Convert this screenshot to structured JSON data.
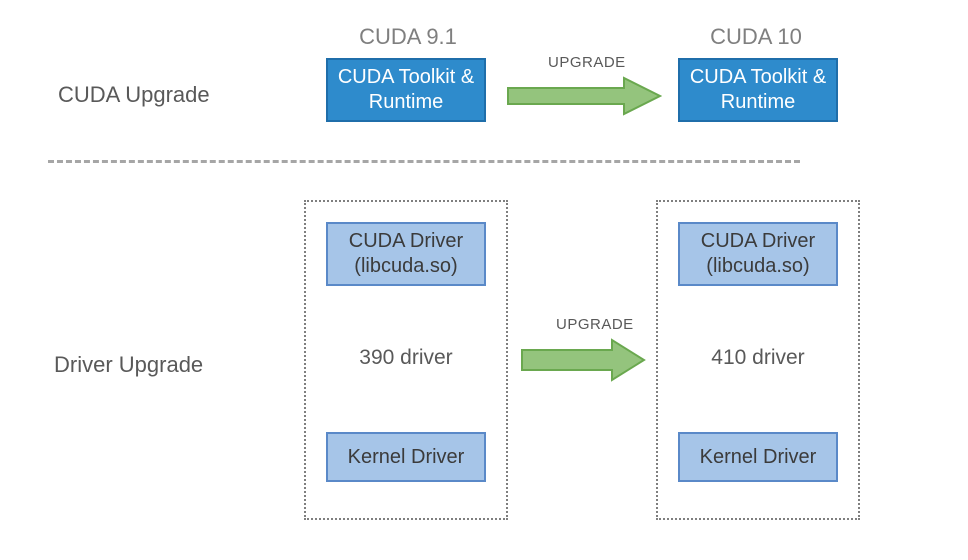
{
  "sections": {
    "cuda": {
      "label": "CUDA Upgrade"
    },
    "driver": {
      "label": "Driver Upgrade"
    }
  },
  "headers": {
    "left": "CUDA 9.1",
    "right": "CUDA 10"
  },
  "boxes": {
    "toolkit_left": "CUDA Toolkit & Runtime",
    "toolkit_right": "CUDA Toolkit & Runtime",
    "cuda_driver_left": "CUDA Driver (libcuda.so)",
    "cuda_driver_right": "CUDA Driver (libcuda.so)",
    "kernel_left": "Kernel Driver",
    "kernel_right": "Kernel Driver"
  },
  "driver_versions": {
    "left": "390 driver",
    "right": "410 driver"
  },
  "arrow_label": "UPGRADE",
  "colors": {
    "blue_solid": "#2e8bcc",
    "blue_solid_border": "#1f6eaa",
    "blue_light": "#a6c5e8",
    "blue_light_border": "#5a89c8",
    "arrow_fill": "#94c47d",
    "arrow_border": "#6aa84f",
    "text_gray": "#595959",
    "header_gray": "#7f7f7f"
  }
}
